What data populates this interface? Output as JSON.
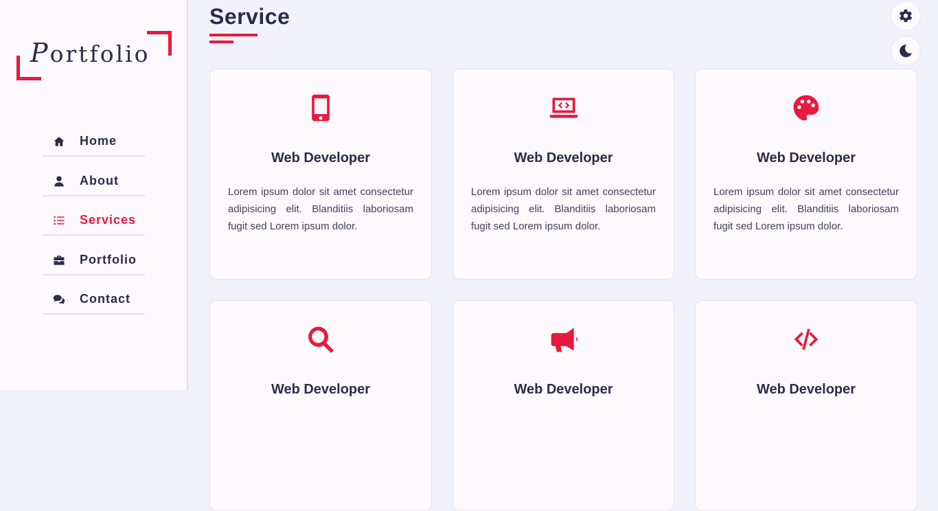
{
  "colors": {
    "accent": "#e8193e",
    "text": "#2b2c4a",
    "sidebar_bg": "#fdf9fd",
    "page_bg": "#f1f2fa"
  },
  "logo": {
    "text_first": "P",
    "text_rest": "ortfolio"
  },
  "nav": {
    "items": [
      {
        "label": "Home",
        "icon": "home-icon",
        "active": false
      },
      {
        "label": "About",
        "icon": "user-icon",
        "active": false
      },
      {
        "label": "Services",
        "icon": "list-icon",
        "active": true
      },
      {
        "label": "Portfolio",
        "icon": "briefcase-icon",
        "active": false
      },
      {
        "label": "Contact",
        "icon": "comments-icon",
        "active": false
      }
    ]
  },
  "header": {
    "title": "Service",
    "settings_icon": "gear-icon",
    "theme_icon": "moon-icon"
  },
  "services": [
    {
      "icon": "mobile-icon",
      "title": "Web Developer",
      "text": "Lorem ipsum dolor sit amet consectetur adipisicing elit. Blanditiis laboriosam fugit sed Lorem ipsum dolor."
    },
    {
      "icon": "laptop-code-icon",
      "title": "Web Developer",
      "text": "Lorem ipsum dolor sit amet consectetur adipisicing elit. Blanditiis laboriosam fugit sed Lorem ipsum dolor."
    },
    {
      "icon": "palette-icon",
      "title": "Web Developer",
      "text": "Lorem ipsum dolor sit amet consectetur adipisicing elit. Blanditiis laboriosam fugit sed Lorem ipsum dolor."
    },
    {
      "icon": "search-icon",
      "title": "Web Developer",
      "text": ""
    },
    {
      "icon": "megaphone-icon",
      "title": "Web Developer",
      "text": ""
    },
    {
      "icon": "code-icon",
      "title": "Web Developer",
      "text": ""
    }
  ]
}
